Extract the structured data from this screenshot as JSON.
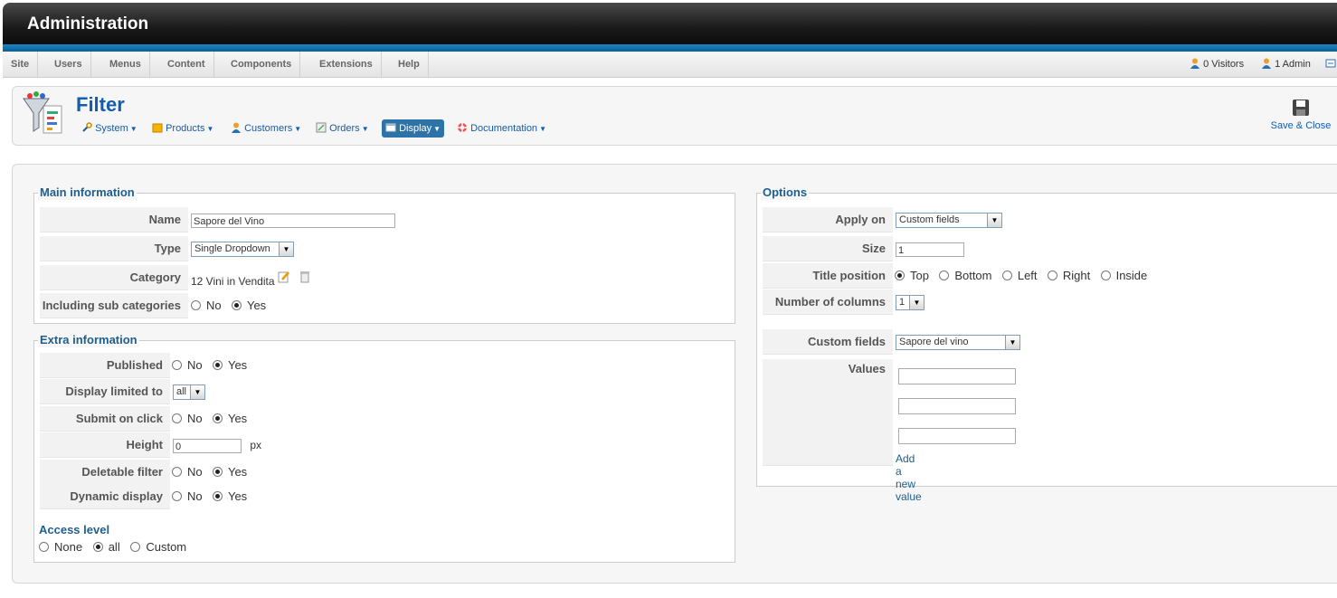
{
  "header": {
    "title": "Administration"
  },
  "menu": {
    "items": [
      "Site",
      "Users",
      "Menus",
      "Content",
      "Components",
      "Extensions",
      "Help"
    ],
    "visitors": "0 Visitors",
    "admins": "1 Admin"
  },
  "toolbar": {
    "page_title": "Filter",
    "nav": [
      "System",
      "Products",
      "Customers",
      "Orders",
      "Display",
      "Documentation"
    ],
    "save_close": "Save & Close"
  },
  "main_info": {
    "legend": "Main information",
    "name_label": "Name",
    "name_value": "Sapore del Vino",
    "type_label": "Type",
    "type_value": "Single Dropdown",
    "category_label": "Category",
    "category_value": "12 Vini in Vendita",
    "subcat_label": "Including sub categories",
    "subcat_no": "No",
    "subcat_yes": "Yes"
  },
  "extra_info": {
    "legend": "Extra information",
    "published_label": "Published",
    "display_limited_label": "Display limited to",
    "display_limited_value": "all",
    "submit_label": "Submit on click",
    "height_label": "Height",
    "height_value": "0",
    "height_unit": "px",
    "deletable_label": "Deletable filter",
    "dynamic_label": "Dynamic display",
    "no": "No",
    "yes": "Yes",
    "access_label": "Access level",
    "access_none": "None",
    "access_all": "all",
    "access_custom": "Custom"
  },
  "options": {
    "legend": "Options",
    "apply_label": "Apply on",
    "apply_value": "Custom fields",
    "size_label": "Size",
    "size_value": "1",
    "title_pos_label": "Title position",
    "pos": [
      "Top",
      "Bottom",
      "Left",
      "Right",
      "Inside"
    ],
    "columns_label": "Number of columns",
    "columns_value": "1",
    "custom_fields_label": "Custom fields",
    "custom_fields_value": "Sapore del vino",
    "values_label": "Values",
    "add_value": "Add a new value"
  }
}
